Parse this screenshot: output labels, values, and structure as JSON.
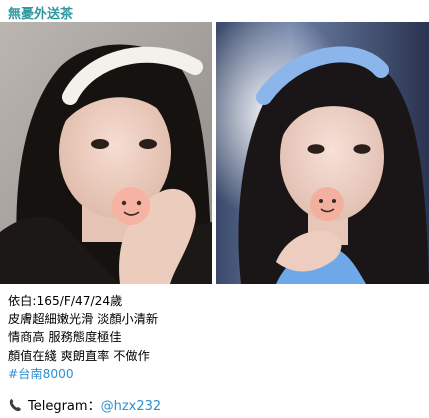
{
  "channel": {
    "name": "無憂外送茶"
  },
  "photos": [
    {
      "icon": "pig-face-sticker",
      "theme": "white-headband"
    },
    {
      "icon": "pig-face-sticker",
      "theme": "blue-headband"
    }
  ],
  "caption": {
    "lines": [
      "依白:165/F/47/24歲",
      "皮膚超細嫩光滑 淡顏小清新",
      "情商高 服務態度極佳",
      "顏值在綫 爽朗直率 不做作"
    ],
    "hashtag": "#台南8000"
  },
  "contact": {
    "icon": "telephone-icon",
    "label": "Telegram：",
    "handle": "@hzx232"
  },
  "colors": {
    "accent": "#2e9aa0",
    "link": "#2f8fd0"
  }
}
